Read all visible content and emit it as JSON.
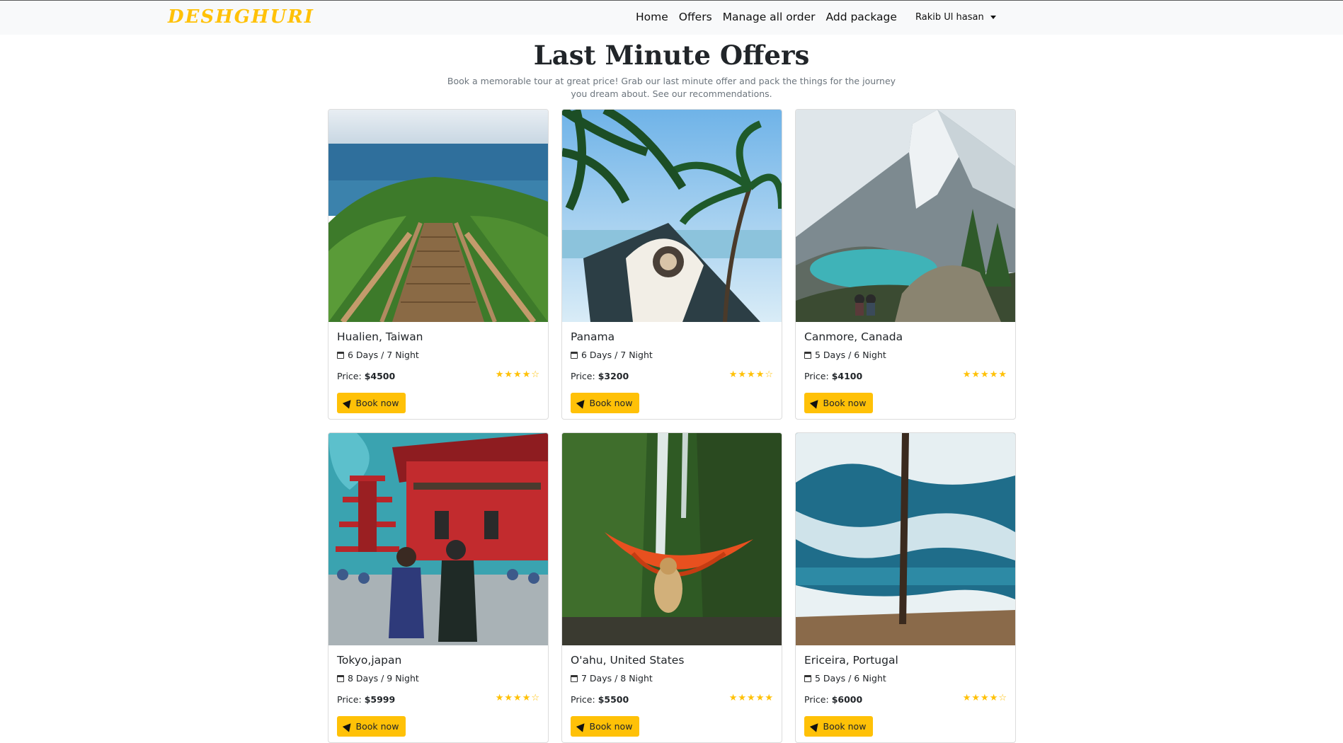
{
  "navbar": {
    "brand": "DESHGHURI",
    "links": [
      "Home",
      "Offers",
      "Manage all order",
      "Add package"
    ],
    "user": "Rakib Ul hasan"
  },
  "hero": {
    "title": "Last Minute Offers",
    "subtitle": "Book a memorable tour at great price! Grab our last minute offer and pack the things for the journey you dream about. See our recommendations."
  },
  "book_label": "Book now",
  "price_label": "Price: ",
  "packages": [
    {
      "name": "Hualien, Taiwan",
      "duration": "6 Days / 7 Night",
      "price": "$4500",
      "rating": 4,
      "image": "wooden stairs to sea"
    },
    {
      "name": "Panama",
      "duration": "6 Days / 7 Night",
      "price": "$3200",
      "rating": 4,
      "image": "palm trees and boat"
    },
    {
      "name": "Canmore, Canada",
      "duration": "5 Days / 6 Night",
      "price": "$4100",
      "rating": 5,
      "image": "mountain lake"
    },
    {
      "name": "Tokyo,japan",
      "duration": "8 Days / 9 Night",
      "price": "$5999",
      "rating": 4,
      "image": "temple gate"
    },
    {
      "name": "O'ahu, United States",
      "duration": "7 Days / 8 Night",
      "price": "$5500",
      "rating": 4.5,
      "image": "waterfall and hammock"
    },
    {
      "name": "Ericeira, Portugal",
      "duration": "5 Days / 6 Night",
      "price": "$6000",
      "rating": 4,
      "image": "ocean waves aerial"
    }
  ],
  "colors": {
    "accent": "#ffc107",
    "nav_bg": "#f8f9fa"
  }
}
